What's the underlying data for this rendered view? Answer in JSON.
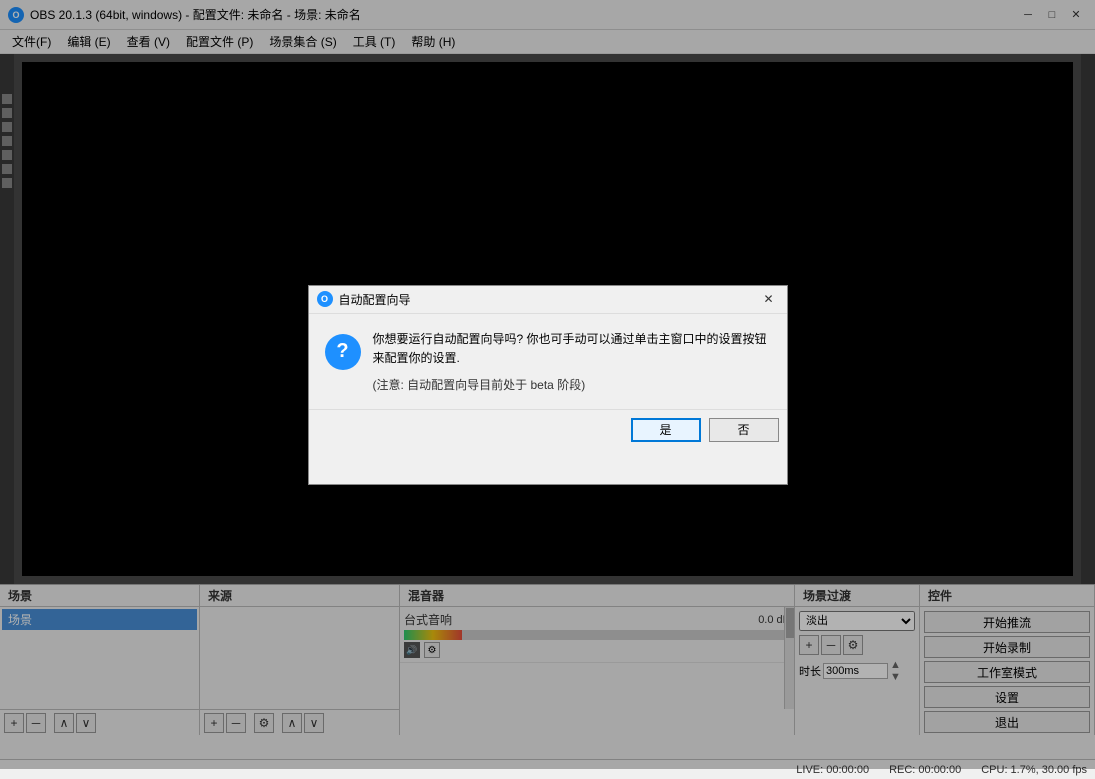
{
  "titlebar": {
    "app_icon_label": "O",
    "title": "OBS 20.1.3 (64bit, windows) - 配置文件: 未命名 - 场景: 未命名",
    "minimize": "─",
    "maximize": "□",
    "close": "✕"
  },
  "menubar": {
    "items": [
      {
        "label": "文件(F)"
      },
      {
        "label": "编辑 (E)"
      },
      {
        "label": "查看 (V)"
      },
      {
        "label": "配置文件 (P)"
      },
      {
        "label": "场景集合 (S)"
      },
      {
        "label": "工具 (T)"
      },
      {
        "label": "帮助 (H)"
      }
    ]
  },
  "panels": {
    "scene_header": "场景",
    "source_header": "来源",
    "mixer_header": "混音器",
    "transition_header": "场景过渡",
    "controls_header": "控件",
    "scene_item": "场景",
    "mixer_channel": {
      "name": "台式音响",
      "db": "0.0 dB"
    },
    "transition": {
      "options": [
        "淡出"
      ],
      "selected": "淡出",
      "duration_label": "时长",
      "duration_value": "300ms"
    },
    "controls": {
      "start_stream": "开始推流",
      "start_record": "开始录制",
      "studio_mode": "工作室模式",
      "settings": "设置",
      "exit": "退出"
    }
  },
  "statusbar": {
    "live": "LIVE: 00:00:00",
    "rec": "REC: 00:00:00",
    "cpu": "CPU: 1.7%, 30.00 fps"
  },
  "dialog": {
    "icon_label": "O",
    "title": "自动配置向导",
    "close_btn": "✕",
    "question_icon": "?",
    "message": "你想要运行自动配置向导吗? 你也可手动可以通过单击主窗口中的设置按钮来配置你的设置.",
    "note": "(注意: 自动配置向导目前处于 beta 阶段)",
    "yes_label": "是",
    "no_label": "否"
  },
  "toolbar": {
    "add": "+",
    "remove": "─",
    "up": "∧",
    "down": "∨",
    "settings": "⚙"
  }
}
